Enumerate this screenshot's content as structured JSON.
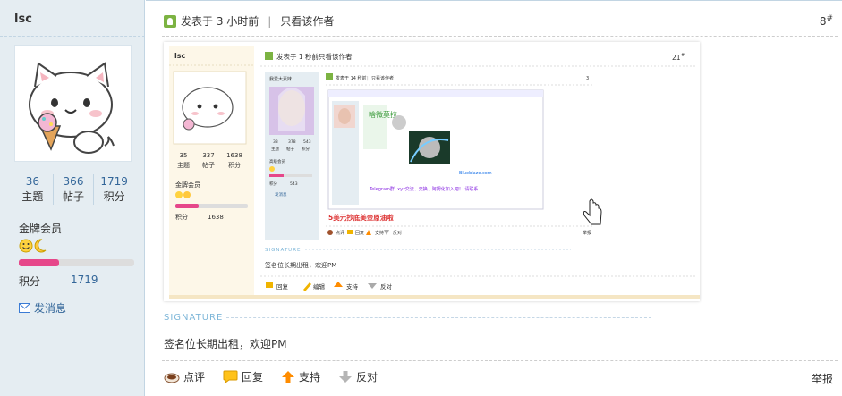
{
  "sidebar": {
    "username": "lsc",
    "stats": [
      {
        "value": "36",
        "label": "主题"
      },
      {
        "value": "366",
        "label": "帖子"
      },
      {
        "value": "1719",
        "label": "积分"
      }
    ],
    "grade": "金牌会员",
    "progress": 0.35,
    "points_label": "积分",
    "points_value": "1719",
    "message_link": "发消息"
  },
  "post": {
    "posted": "发表于 3 小时前",
    "only_author": "只看该作者",
    "floor": "8",
    "floor_mark": "#",
    "signature_heading": "SIGNATURE",
    "signature_text": "签名位长期出租，欢迎PM",
    "actions": [
      "点评",
      "回复",
      "支持",
      "反对"
    ],
    "report": "举报"
  },
  "nested": {
    "username": "lsc",
    "posted": "发表于 1 秒前",
    "only_author": "只看该作者",
    "floor": "21",
    "stats": [
      {
        "value": "35",
        "label": "主题"
      },
      {
        "value": "337",
        "label": "帖子"
      },
      {
        "value": "1638",
        "label": "积分"
      }
    ],
    "grade": "金牌会员",
    "points_label": "积分",
    "points_value": "1638",
    "signature_heading": "SIGNATURE",
    "signature_text": "签名位长期出租，欢迎PM",
    "actions": [
      "回复",
      "编辑",
      "支持",
      "反对"
    ]
  },
  "inner": {
    "username": "我爱大素妹",
    "posted": "发表于 14 秒前",
    "only_author": "只看该作者",
    "floor": "3",
    "stats": [
      {
        "value": "33",
        "label": "主题"
      },
      {
        "value": "378",
        "label": "帖子"
      },
      {
        "value": "543",
        "label": "积分"
      }
    ],
    "grade": "高级会员",
    "points_label": "积分",
    "points_value": "543",
    "message_link": "发消息",
    "telegram_text": "Telegram群: xyz交流、交换、阿姆化加入吧！ 请联系",
    "promo_text": "5美元抄底美金原油啦",
    "actions": [
      "点评",
      "回复",
      "支持",
      "反对"
    ],
    "report": "举报",
    "img_label": "啥微莫拉",
    "watermark": "Blueblaze.com"
  }
}
